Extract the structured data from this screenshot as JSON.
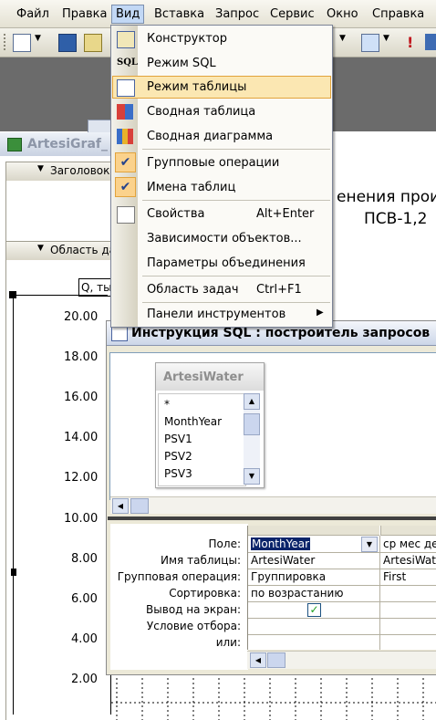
{
  "menubar": {
    "items": [
      {
        "label": "Файл"
      },
      {
        "label": "Правка"
      },
      {
        "label": "Вид"
      },
      {
        "label": "Вставка"
      },
      {
        "label": "Запрос"
      },
      {
        "label": "Сервис"
      },
      {
        "label": "Окно"
      },
      {
        "label": "Справка"
      }
    ]
  },
  "report_window": {
    "title": "ArtesiGraf_",
    "header_band": "Заголовок о",
    "data_band": "Область да",
    "heading_line1": "енения произ",
    "heading_line2": "ПСВ-1,2",
    "field_box": "Q, ты",
    "y_axis": [
      "20.00",
      "18.00",
      "16.00",
      "14.00",
      "12.00",
      "10.00",
      "8.00",
      "6.00",
      "4.00",
      "2.00"
    ]
  },
  "view_menu": {
    "items": [
      {
        "label": "Конструктор",
        "icon": "design-icon"
      },
      {
        "label": "Режим SQL",
        "icon": "sql-icon"
      },
      {
        "label": "Режим таблицы",
        "icon": "datasheet-icon",
        "highlighted": true
      },
      {
        "label": "Сводная таблица",
        "icon": "pivot-table-icon"
      },
      {
        "label": "Сводная диаграмма",
        "icon": "pivot-chart-icon"
      },
      {
        "label": "Групповые операции",
        "checked": true
      },
      {
        "label": "Имена таблиц",
        "checked": true
      },
      {
        "label": "Свойства",
        "shortcut": "Alt+Enter",
        "icon": "properties-icon"
      },
      {
        "label": "Зависимости объектов..."
      },
      {
        "label": "Параметры объединения"
      },
      {
        "label": "Область задач",
        "shortcut": "Ctrl+F1"
      },
      {
        "label": "Панели инструментов",
        "submenu": true
      }
    ]
  },
  "sql_builder": {
    "title": "Инструкция SQL : построитель запросов",
    "table": {
      "name": "ArtesiWater",
      "fields": [
        "*",
        "MonthYear",
        "PSV1",
        "PSV2",
        "PSV3"
      ]
    },
    "grid": {
      "row_labels": [
        "Поле:",
        "Имя таблицы:",
        "Групповая операция:",
        "Сортировка:",
        "Вывод на экран:",
        "Условие отбора:",
        "или:"
      ],
      "col1": {
        "field": "MonthYear",
        "table": "ArtesiWater",
        "group": "Группировка",
        "sort": "по возрастанию",
        "show": true
      },
      "col2": {
        "field": "ср мес деб",
        "table": "ArtesiWate",
        "group": "First"
      }
    }
  },
  "colors": {
    "accent": "#fbe7b2",
    "title_text": "#000000",
    "selection": "#0a246a"
  }
}
